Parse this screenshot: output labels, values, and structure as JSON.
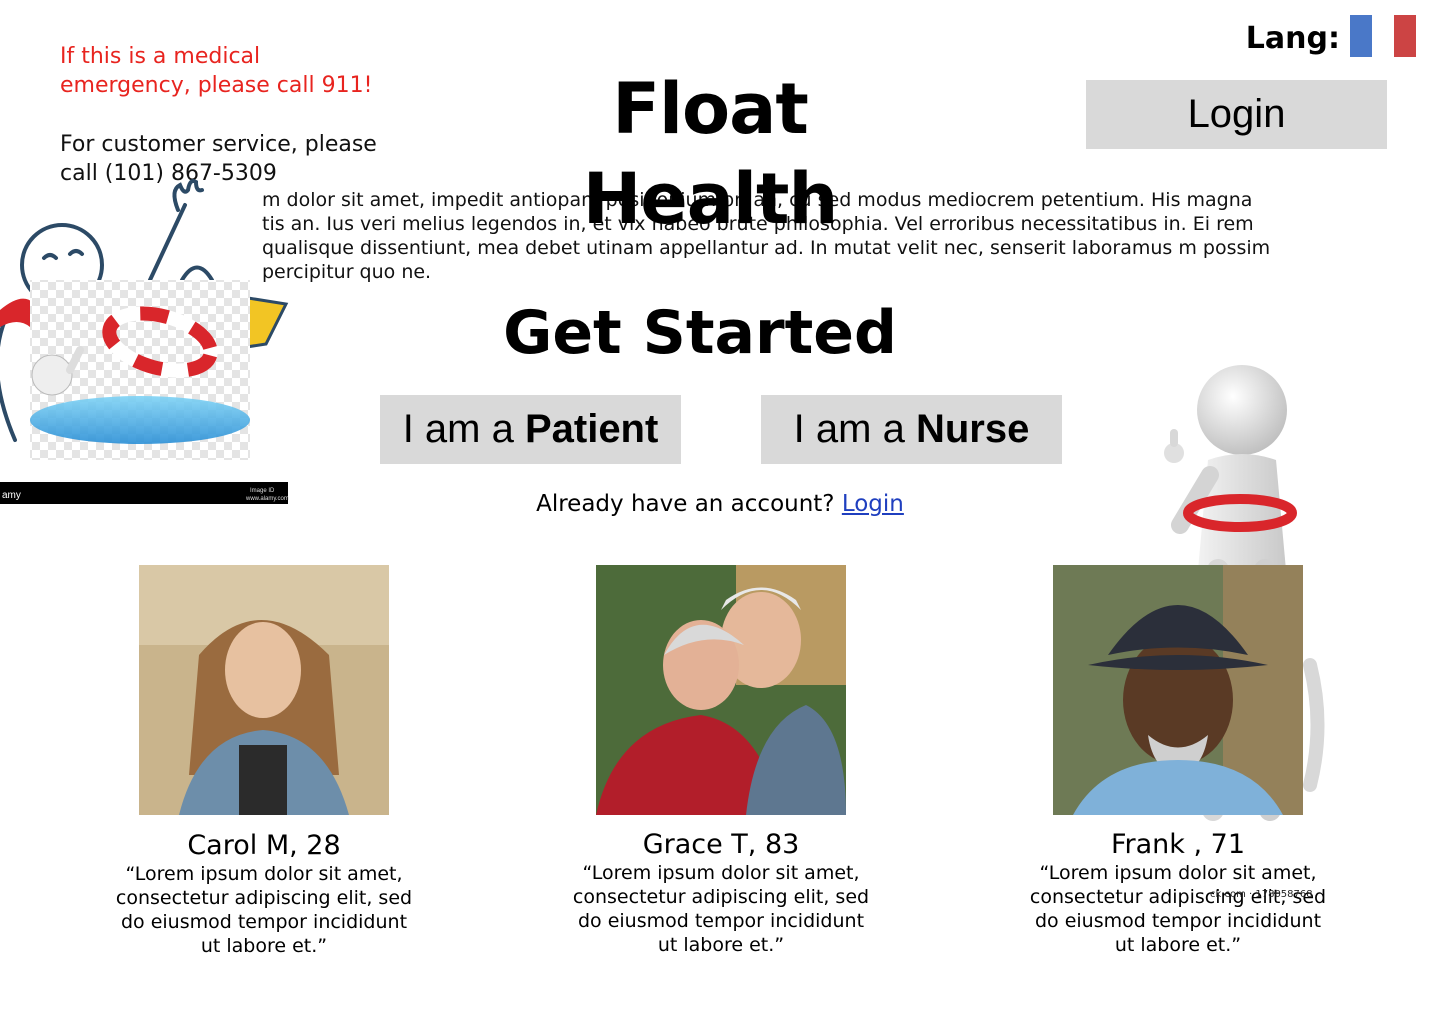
{
  "notice": {
    "emergency": "If this is a medical emergency, please call 911!",
    "service": "For customer service, please call (101) 867-5309"
  },
  "header": {
    "title": "Float Health",
    "lang_label": "Lang:",
    "flag_colors": [
      "#4a78c8",
      "#ffffff",
      "#cc4444"
    ],
    "login_label": "Login"
  },
  "intro": {
    "text": "m dolor sit amet, impedit antiopam posidonium pri an, cu sed modus mediocrem petentium. His magna tis an. Ius veri melius legendos in, et vix habeo brute philosophia. Vel erroribus necessitatibus in. Ei rem qualisque dissentiunt, mea debet utinam appellantur ad. In mutat velit nec, senserit laboramus m possim percipitur quo ne."
  },
  "get_started": {
    "heading": "Get Started",
    "patient_prefix": "I am a ",
    "patient_bold": "Patient",
    "nurse_prefix": "I am a ",
    "nurse_bold": "Nurse",
    "account_text": "Already have an account?",
    "account_link": "Login"
  },
  "testimonials": [
    {
      "name": "Carol M, 28",
      "quote": "“Lorem ipsum dolor sit amet, consectetur adipiscing elit, sed do eiusmod tempor incididunt ut labore et.”"
    },
    {
      "name": "Grace T, 83",
      "quote": "“Lorem ipsum dolor sit amet, consectetur adipiscing elit, sed do eiusmod tempor incididunt ut labore et.”"
    },
    {
      "name": "Frank , 71",
      "quote": "“Lorem ipsum dolor sit amet, consectetur adipiscing elit, sed do eiusmod tempor incididunt ut labore et.”"
    }
  ],
  "watermark": "ck.com · 178058768",
  "colors": {
    "emergency": "#e8241f",
    "button_bg": "#d9d9d9",
    "link": "#1f3fbf"
  }
}
